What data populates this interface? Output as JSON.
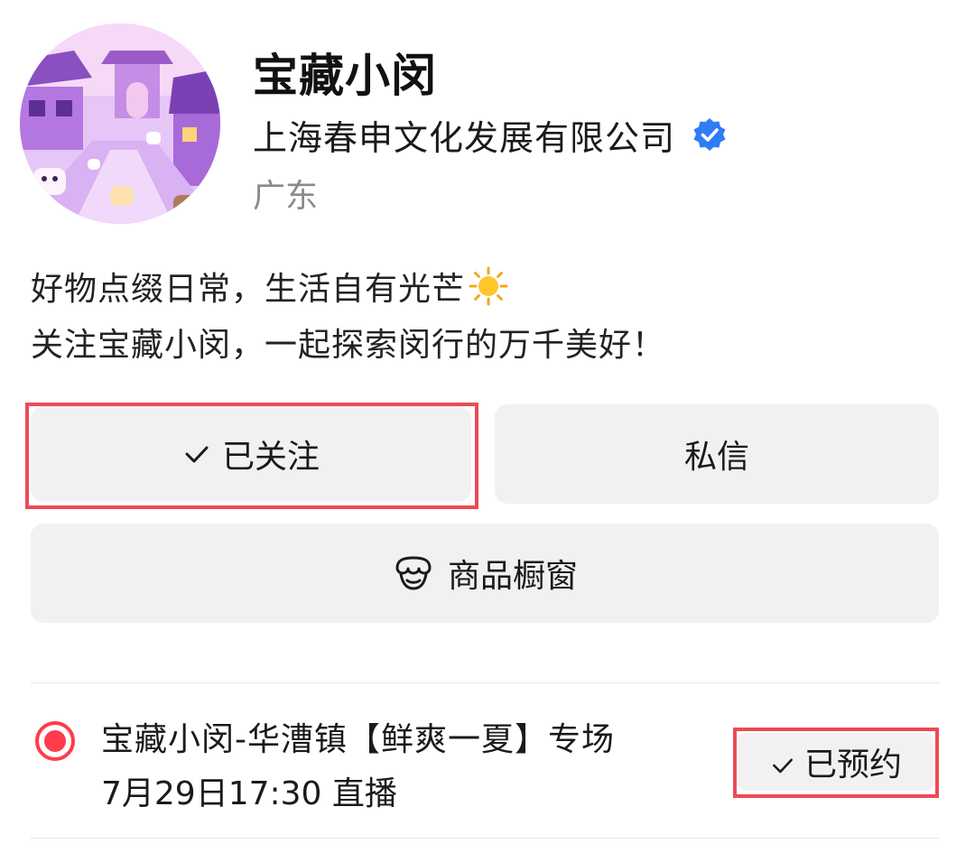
{
  "profile": {
    "name": "宝藏小闵",
    "company": "上海春申文化发展有限公司",
    "location": "广东",
    "verified_icon": "verified-badge-icon",
    "avatar_icon": "avatar-illustration"
  },
  "bio": {
    "line1": "好物点缀日常，生活自有光芒",
    "line2": "关注宝藏小闵，一起探索闵行的万千美好！",
    "emoji": "sun-icon"
  },
  "actions": {
    "follow_label": "已关注",
    "message_label": "私信",
    "shop_label": "商品橱窗"
  },
  "live": {
    "title": "宝藏小闵-华漕镇【鲜爽一夏】专场",
    "time": "7月29日17:30 直播",
    "reserve_label": "已预约"
  },
  "colors": {
    "accent_red": "#ec4b55",
    "live_dot": "#fe3c4a",
    "verified_blue": "#2f7cf6",
    "button_bg": "#f1f1f2"
  }
}
